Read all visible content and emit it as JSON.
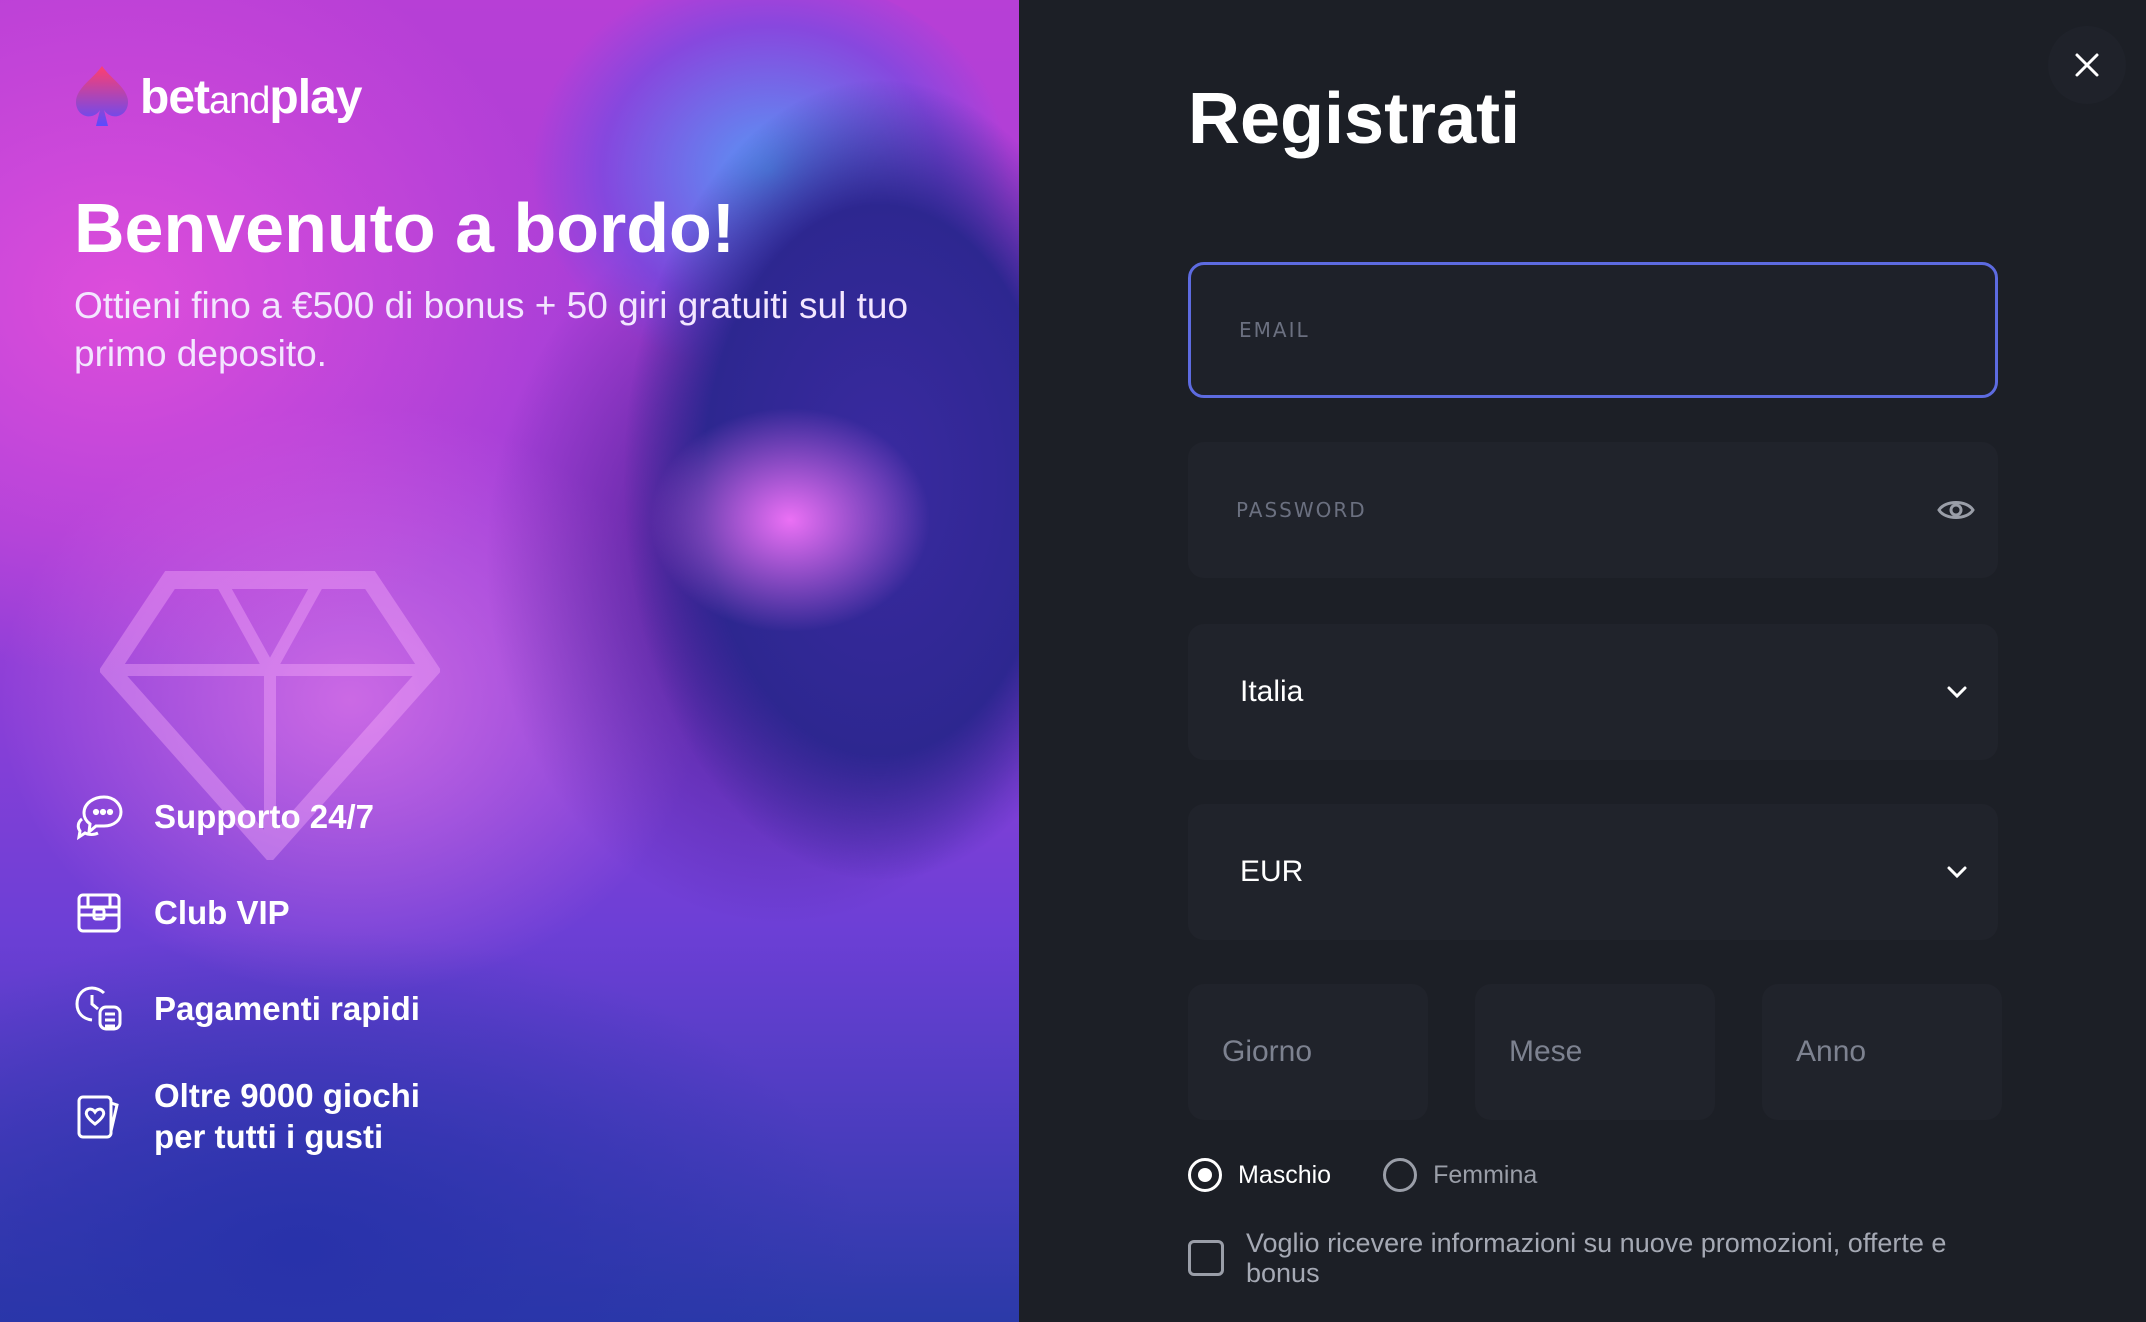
{
  "brand": {
    "part1": "bet",
    "part2": "and",
    "part3": "play"
  },
  "hero": {
    "title": "Benvenuto a bordo!",
    "subtitle": "Ottieni fino a €500 di bonus + 50 giri gratuiti sul tuo primo deposito.",
    "features": [
      {
        "icon": "chat-bubbles-icon",
        "label": "Supporto 24/7"
      },
      {
        "icon": "treasure-chest-icon",
        "label": "Club VIP"
      },
      {
        "icon": "clock-coins-icon",
        "label": "Pagamenti rapidi"
      },
      {
        "icon": "playing-card-heart-icon",
        "label": "Oltre 9000 giochi per tutti i gusti"
      }
    ]
  },
  "form": {
    "title": "Registrati",
    "email_placeholder": "EMAIL",
    "password_placeholder": "PASSWORD",
    "country": "Italia",
    "currency": "EUR",
    "day_placeholder": "Giorno",
    "month_placeholder": "Mese",
    "year_placeholder": "Anno",
    "gender_male": "Maschio",
    "gender_female": "Femmina",
    "newsletter_label": "Voglio ricevere informazioni su nuove promozioni, offerte e bonus"
  },
  "colors": {
    "accent": "#5d6be0",
    "panel": "#1c1f26",
    "field": "#20232b"
  }
}
